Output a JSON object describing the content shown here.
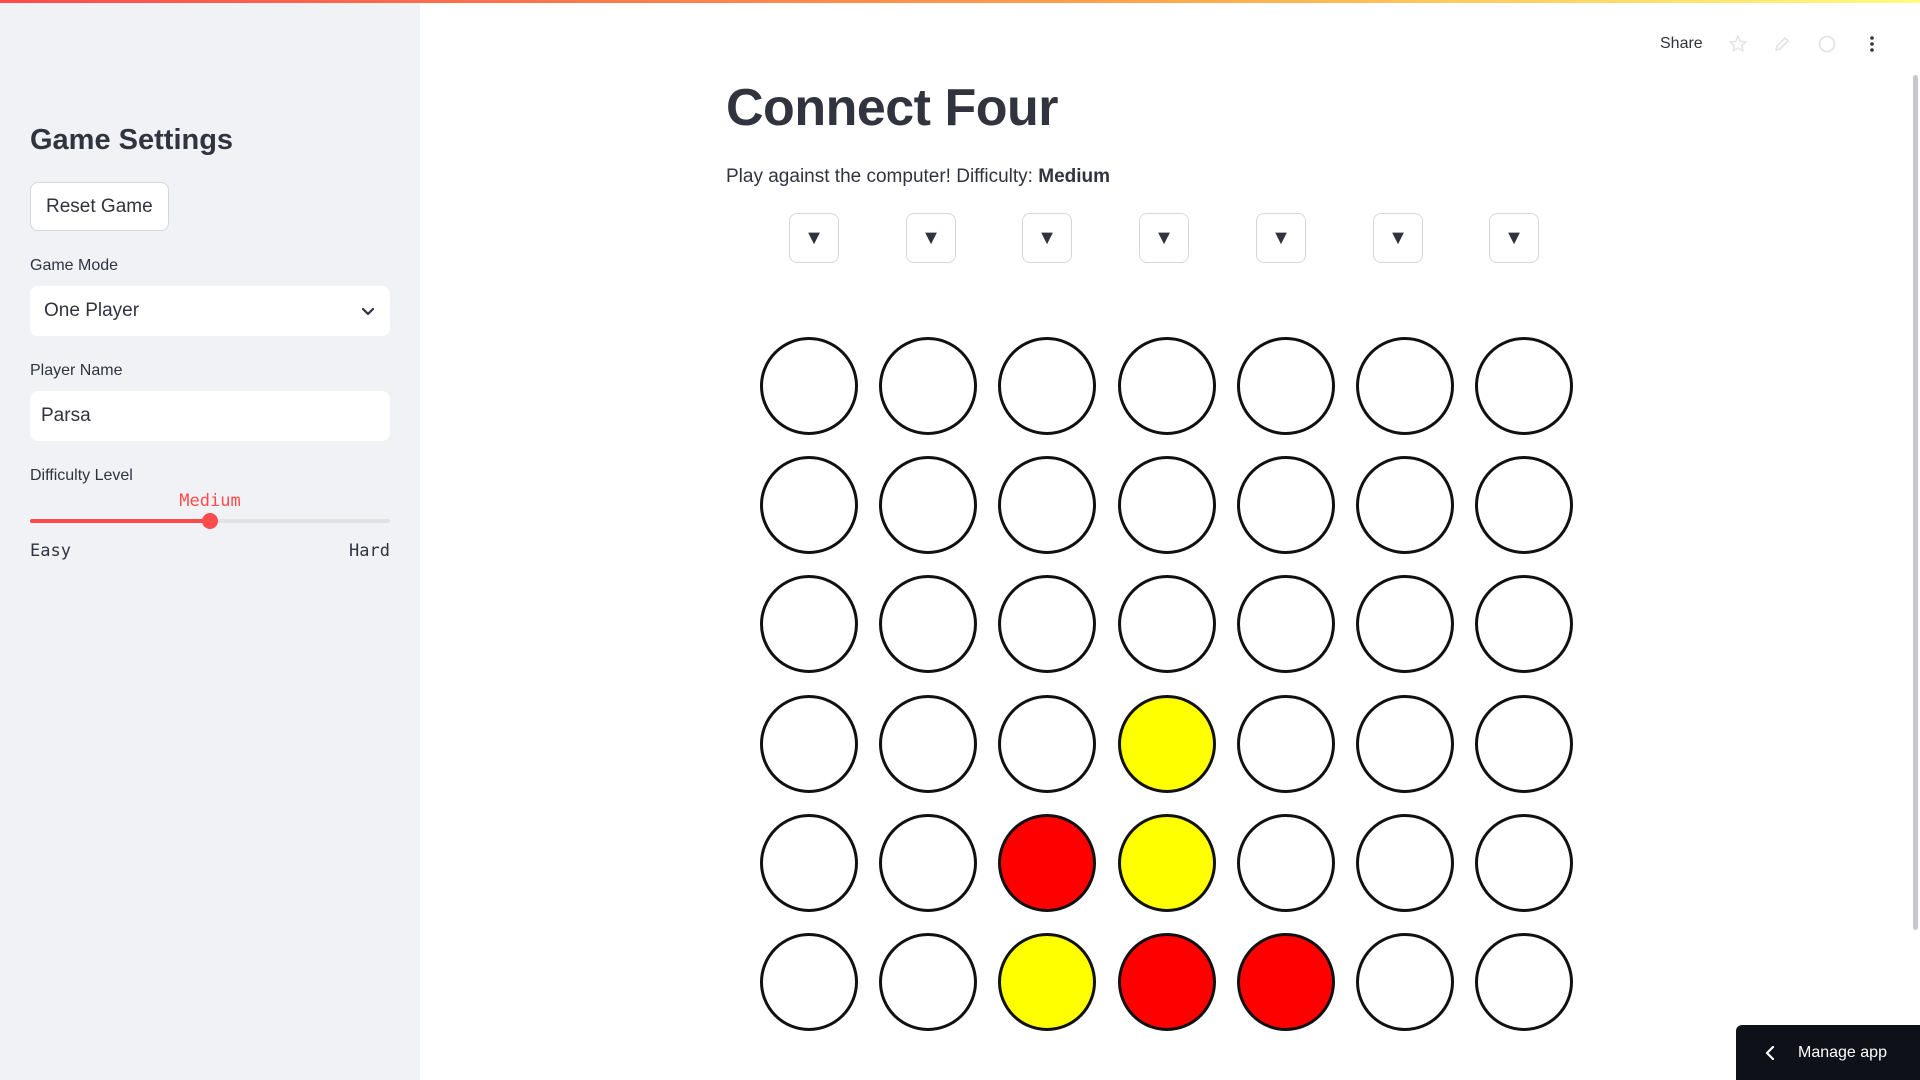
{
  "header": {
    "share_label": "Share",
    "icons": [
      "star-icon",
      "edit-icon",
      "github-icon",
      "more-vertical-icon"
    ]
  },
  "sidebar": {
    "heading": "Game Settings",
    "reset_button_label": "Reset Game",
    "game_mode": {
      "label": "Game Mode",
      "value": "One Player"
    },
    "player_name": {
      "label": "Player Name",
      "value": "Parsa"
    },
    "difficulty": {
      "label": "Difficulty Level",
      "value": "Medium",
      "min_label": "Easy",
      "max_label": "Hard",
      "fraction": 0.5
    }
  },
  "main": {
    "title": "Connect Four",
    "subtitle_prefix": "Play against the computer! Difficulty: ",
    "subtitle_difficulty": "Medium",
    "drop_buttons": [
      "▼",
      "▼",
      "▼",
      "▼",
      "▼",
      "▼",
      "▼"
    ],
    "board": [
      [
        "",
        "",
        "",
        "",
        "",
        "",
        ""
      ],
      [
        "",
        "",
        "",
        "",
        "",
        "",
        ""
      ],
      [
        "",
        "",
        "",
        "",
        "",
        "",
        ""
      ],
      [
        "",
        "",
        "",
        "Y",
        "",
        "",
        ""
      ],
      [
        "",
        "",
        "R",
        "Y",
        "",
        "",
        ""
      ],
      [
        "",
        "",
        "Y",
        "R",
        "R",
        "",
        ""
      ]
    ]
  },
  "manage_app_label": "Manage app",
  "colors": {
    "accent": "#ff4b4b",
    "piece_red": "#ff0000",
    "piece_yellow": "#ffff00",
    "empty_cell": "#ffffff",
    "cell_border": "#111111",
    "sidebar_bg": "#f0f2f6"
  }
}
